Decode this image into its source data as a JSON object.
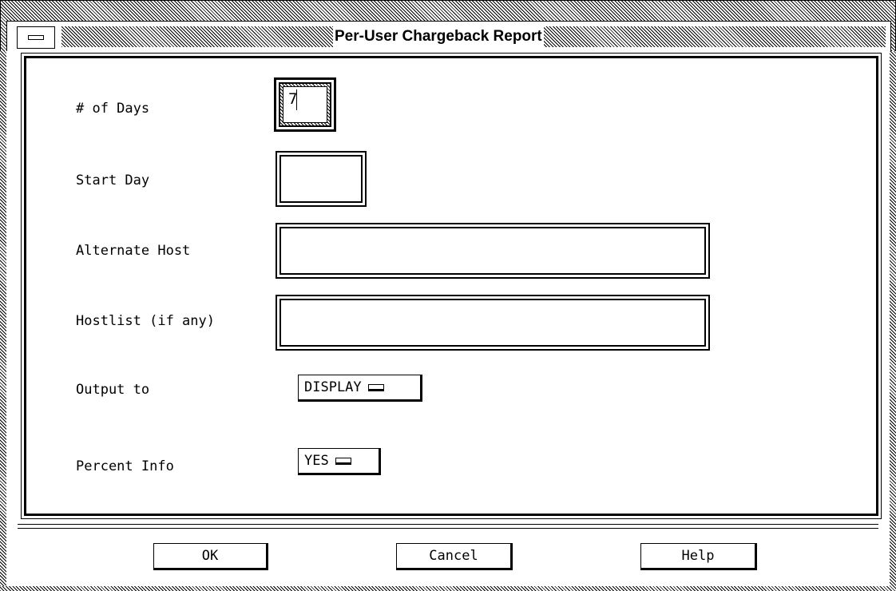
{
  "window": {
    "title": "Per-User Chargeback Report"
  },
  "form": {
    "fields": [
      {
        "label": "# of Days",
        "value": "7"
      },
      {
        "label": "Start Day",
        "value": ""
      },
      {
        "label": "Alternate Host",
        "value": ""
      },
      {
        "label": "Hostlist (if any)",
        "value": ""
      }
    ],
    "options": [
      {
        "label": "Output to",
        "selected": "DISPLAY"
      },
      {
        "label": "Percent Info",
        "selected": "YES"
      }
    ]
  },
  "buttons": {
    "ok": "OK",
    "cancel": "Cancel",
    "help": "Help"
  }
}
